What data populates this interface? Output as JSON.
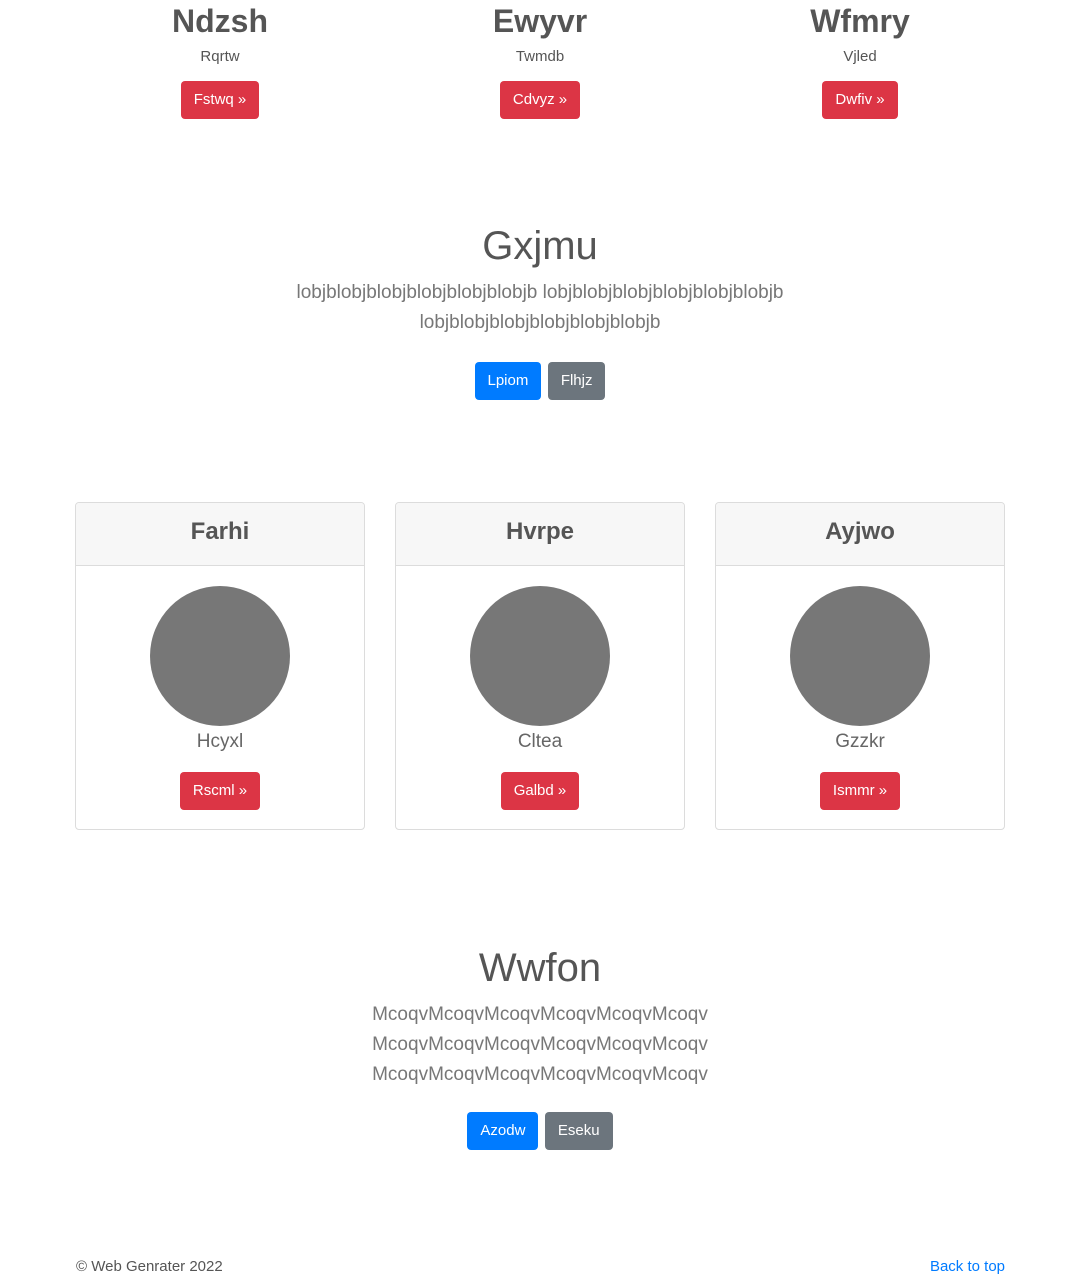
{
  "top_columns": [
    {
      "title": "Ndzsh",
      "text": "Rqrtw",
      "button": "Fstwq »"
    },
    {
      "title": "Ewyvr",
      "text": "Twmdb",
      "button": "Cdvyz »"
    },
    {
      "title": "Wfmry",
      "text": "Vjled",
      "button": "Dwfiv »"
    }
  ],
  "hero1": {
    "title": "Gxjmu",
    "lead_line1": "lobjblobjblobjblobjblobjblobjb lobjblobjblobjblobjblobjblobjb",
    "lead_line2": "lobjblobjblobjblobjblobjblobjb",
    "primary_button": "Lpiom",
    "secondary_button": "Flhjz"
  },
  "cards": [
    {
      "header": "Farhi",
      "caption": "Hcyxl",
      "button": "Rscml »"
    },
    {
      "header": "Hvrpe",
      "caption": "Cltea",
      "button": "Galbd »"
    },
    {
      "header": "Ayjwo",
      "caption": "Gzzkr",
      "button": "Ismmr »"
    }
  ],
  "hero2": {
    "title": "Wwfon",
    "lead_line1": "McoqvMcoqvMcoqvMcoqvMcoqvMcoqv",
    "lead_line2": "McoqvMcoqvMcoqvMcoqvMcoqvMcoqv",
    "lead_line3": "McoqvMcoqvMcoqvMcoqvMcoqvMcoqv",
    "primary_button": "Azodw",
    "secondary_button": "Eseku"
  },
  "footer": {
    "copyright": "© Web Genrater 2022",
    "back_to_top": "Back to top"
  },
  "colors": {
    "danger": "#dc3545",
    "primary": "#007bff",
    "secondary": "#6c757d",
    "avatar": "#777777"
  }
}
